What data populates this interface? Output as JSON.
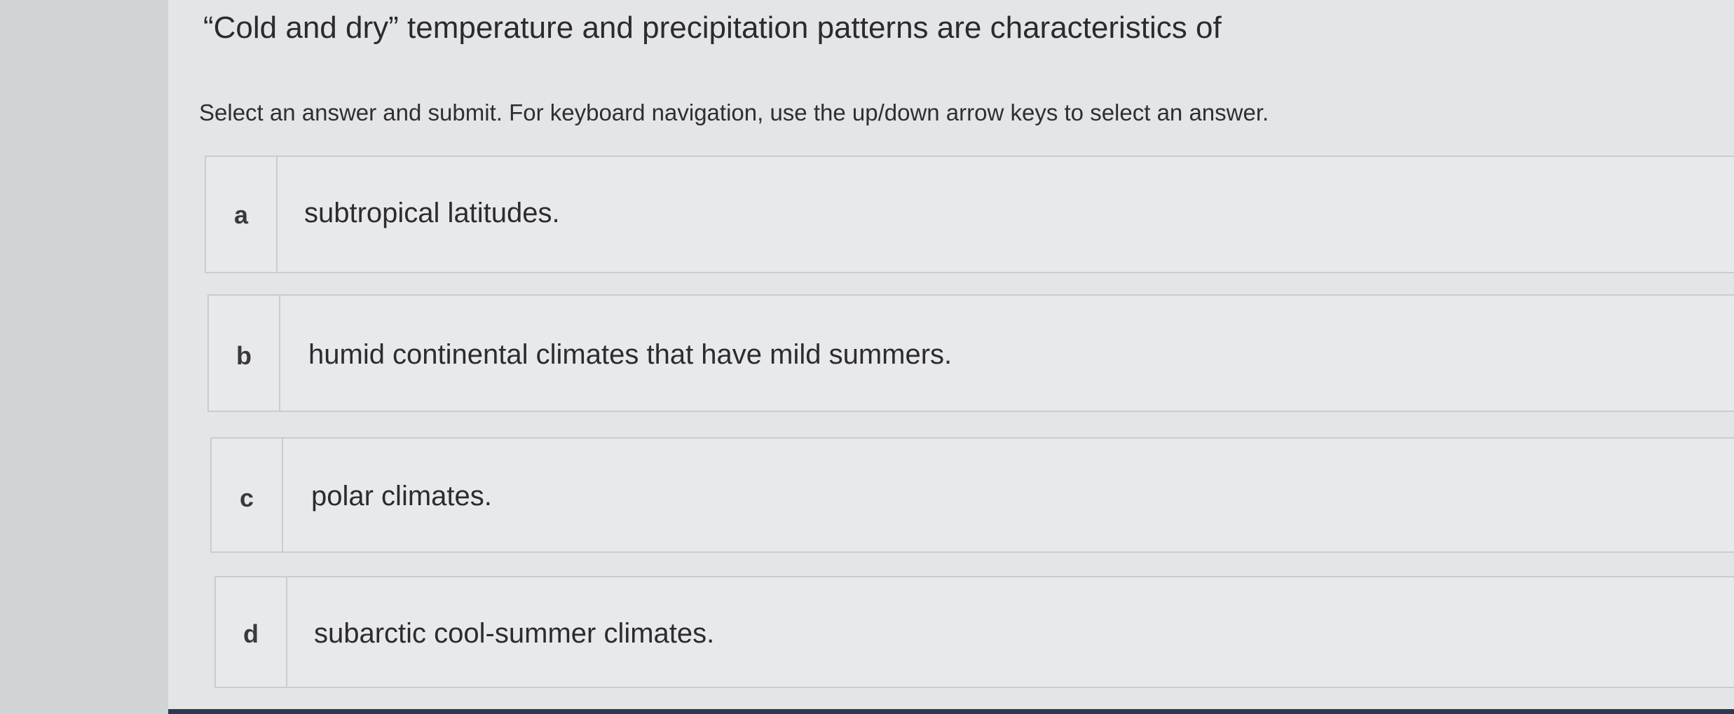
{
  "question": {
    "text": "“Cold and dry” temperature and precipitation patterns are characteristics of"
  },
  "instructions": {
    "text": "Select an answer and submit. For keyboard navigation, use the up/down arrow keys to select an answer."
  },
  "choices": [
    {
      "letter": "a",
      "text": "subtropical latitudes."
    },
    {
      "letter": "b",
      "text": "humid continental climates that have mild summers."
    },
    {
      "letter": "c",
      "text": "polar climates."
    },
    {
      "letter": "d",
      "text": "subarctic cool-summer climates."
    }
  ],
  "colors": {
    "background": "#e4e5e7",
    "choice_background": "#e8e9eb",
    "border": "#cbccce",
    "text": "#2c2c2e",
    "bottom_strip": "#2e3950"
  }
}
